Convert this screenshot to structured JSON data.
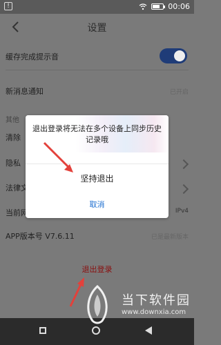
{
  "status": {
    "time": "00:06"
  },
  "header": {
    "title": "设置"
  },
  "settings": {
    "cache_sound": {
      "label": "缓存完成提示音",
      "enabled": true
    },
    "new_message": {
      "label": "新消息通知",
      "value": "已开启"
    },
    "other_section_partial": "其他",
    "clear_partial": "清除",
    "privacy_partial": "隐私",
    "legal_partial": "法律文",
    "current_network_partial": "当前网",
    "ip_value": "IPv4",
    "app_version": {
      "label": "APP版本号 V7.6.11",
      "value": "已是最新版本"
    }
  },
  "dialog": {
    "message": "退出登录将无法在多个设备上同步历史记录哦",
    "confirm": "坚持退出",
    "cancel": "取消"
  },
  "logout": {
    "label": "退出登录"
  },
  "watermark": {
    "brand": "当下软件园",
    "url": "www.downxia.com"
  },
  "colors": {
    "accent": "#1f3c78",
    "cancel_blue": "#1e6fd0",
    "logout_red": "#8a0f0f",
    "arrow_red": "#e3413b"
  }
}
